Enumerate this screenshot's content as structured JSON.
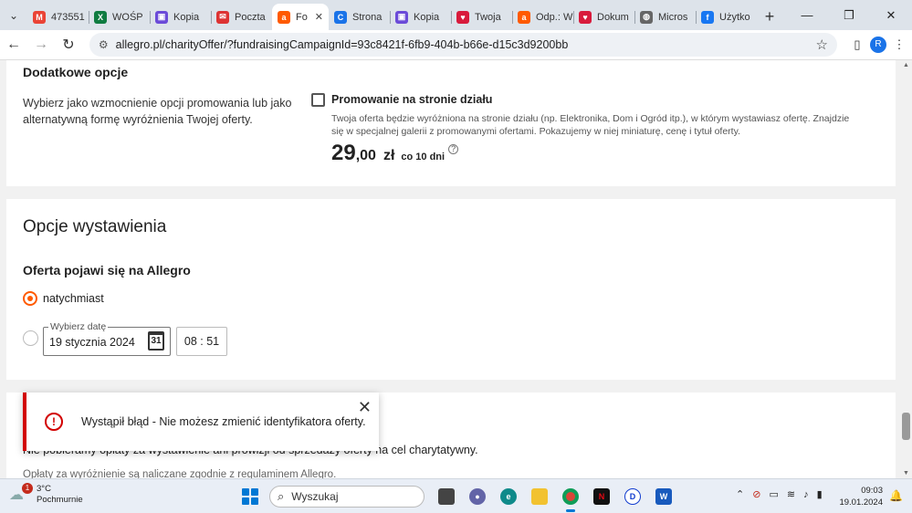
{
  "browser": {
    "tabs": [
      {
        "title": "473551",
        "icon": "gmail-icon",
        "color": "#ea4335",
        "glyph": "M"
      },
      {
        "title": "WOŚP",
        "icon": "excel-icon",
        "color": "#107c41",
        "glyph": "X"
      },
      {
        "title": "Kopia",
        "icon": "doc-icon",
        "color": "#6b4bd8",
        "glyph": "▣"
      },
      {
        "title": "Poczta",
        "icon": "mail-icon",
        "color": "#d33",
        "glyph": "✉"
      },
      {
        "title": "Fo",
        "icon": "allegro-icon",
        "color": "#ff5a00",
        "glyph": "a"
      },
      {
        "title": "Strona",
        "icon": "circle-icon",
        "color": "#1a73e8",
        "glyph": "C"
      },
      {
        "title": "Kopia",
        "icon": "doc-icon",
        "color": "#6b4bd8",
        "glyph": "▣"
      },
      {
        "title": "Twoja",
        "icon": "heart-icon",
        "color": "#d81b3c",
        "glyph": "♥"
      },
      {
        "title": "Odp.: W",
        "icon": "allegro-icon",
        "color": "#ff5a00",
        "glyph": "a"
      },
      {
        "title": "Dokum",
        "icon": "heart-icon",
        "color": "#d81b3c",
        "glyph": "♥"
      },
      {
        "title": "Micros",
        "icon": "globe-icon",
        "color": "#666",
        "glyph": "◍"
      },
      {
        "title": "Użytko",
        "icon": "facebook-icon",
        "color": "#1877f2",
        "glyph": "f"
      }
    ],
    "active_tab_index": 4,
    "url": "allegro.pl/charityOffer/?fundraisingCampaignId=93c8421f-6fb9-404b-b66e-d15c3d9200bb",
    "profile_initial": "R"
  },
  "options": {
    "title": "Dodatkowe opcje",
    "description": "Wybierz jako wzmocnienie opcji promowania lub jako alternatywną formę wyróżnienia Twojej oferty.",
    "promo": {
      "label": "Promowanie na stronie działu",
      "checked": false,
      "description": "Twoja oferta będzie wyróżniona na stronie działu (np. Elektronika, Dom i Ogród itp.), w którym wystawiasz ofertę. Znajdzie się w specjalnej galerii z promowanymi ofertami. Pokazujemy w niej miniaturę, cenę i tytuł oferty.",
      "price_int": "29",
      "price_dec": ",00",
      "currency": "zł",
      "period": "co 10 dni"
    }
  },
  "listing": {
    "title": "Opcje wystawienia",
    "subtitle": "Oferta pojawi się na Allegro",
    "option_now": "natychmiast",
    "selected": "now",
    "date_label": "Wybierz datę",
    "date_value": "19 stycznia 2024",
    "calendar_day": "31",
    "time_value": "08 : 51"
  },
  "fees": {
    "line1": "Nie pobieramy opłaty za wystawienie ani prowizji od sprzedaży oferty na cel charytatywny.",
    "line2": "Opłaty za wyróżnienie są naliczane zgodnie z regulaminem Allegro."
  },
  "toast": {
    "message": "Wystąpił błąd - Nie możesz zmienić identyfikatora oferty.",
    "accent": "#d20000"
  },
  "taskbar": {
    "temperature": "3°C",
    "weather": "Pochmurnie",
    "weather_badge": "1",
    "search_placeholder": "Wyszukaj",
    "time": "09:03",
    "date": "19.01.2024"
  }
}
